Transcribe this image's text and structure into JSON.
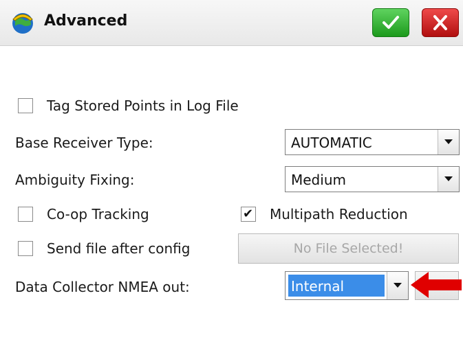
{
  "window": {
    "title": "Advanced"
  },
  "toolbar": {
    "ok_icon": "checkmark-icon",
    "cancel_icon": "close-icon"
  },
  "options": {
    "tag_stored_points": {
      "label": "Tag Stored Points in Log File",
      "checked": false
    },
    "base_receiver_type": {
      "label": "Base Receiver Type:",
      "value": "AUTOMATIC"
    },
    "ambiguity_fixing": {
      "label": "Ambiguity Fixing:",
      "value": "Medium"
    },
    "coop_tracking": {
      "label": "Co-op Tracking",
      "checked": false
    },
    "multipath_reduction": {
      "label": "Multipath Reduction",
      "checked": true
    },
    "send_file_after_config": {
      "label": "Send file after config",
      "checked": false
    },
    "file_button": {
      "label": "No File Selected!"
    },
    "data_collector_nmea_out": {
      "label": "Data Collector NMEA out:",
      "value": "Internal"
    }
  },
  "colors": {
    "ok_green": "#1c9a1c",
    "cancel_red": "#b10f0f",
    "selection_blue": "#3b8de8",
    "annotation_red": "#e00000"
  }
}
